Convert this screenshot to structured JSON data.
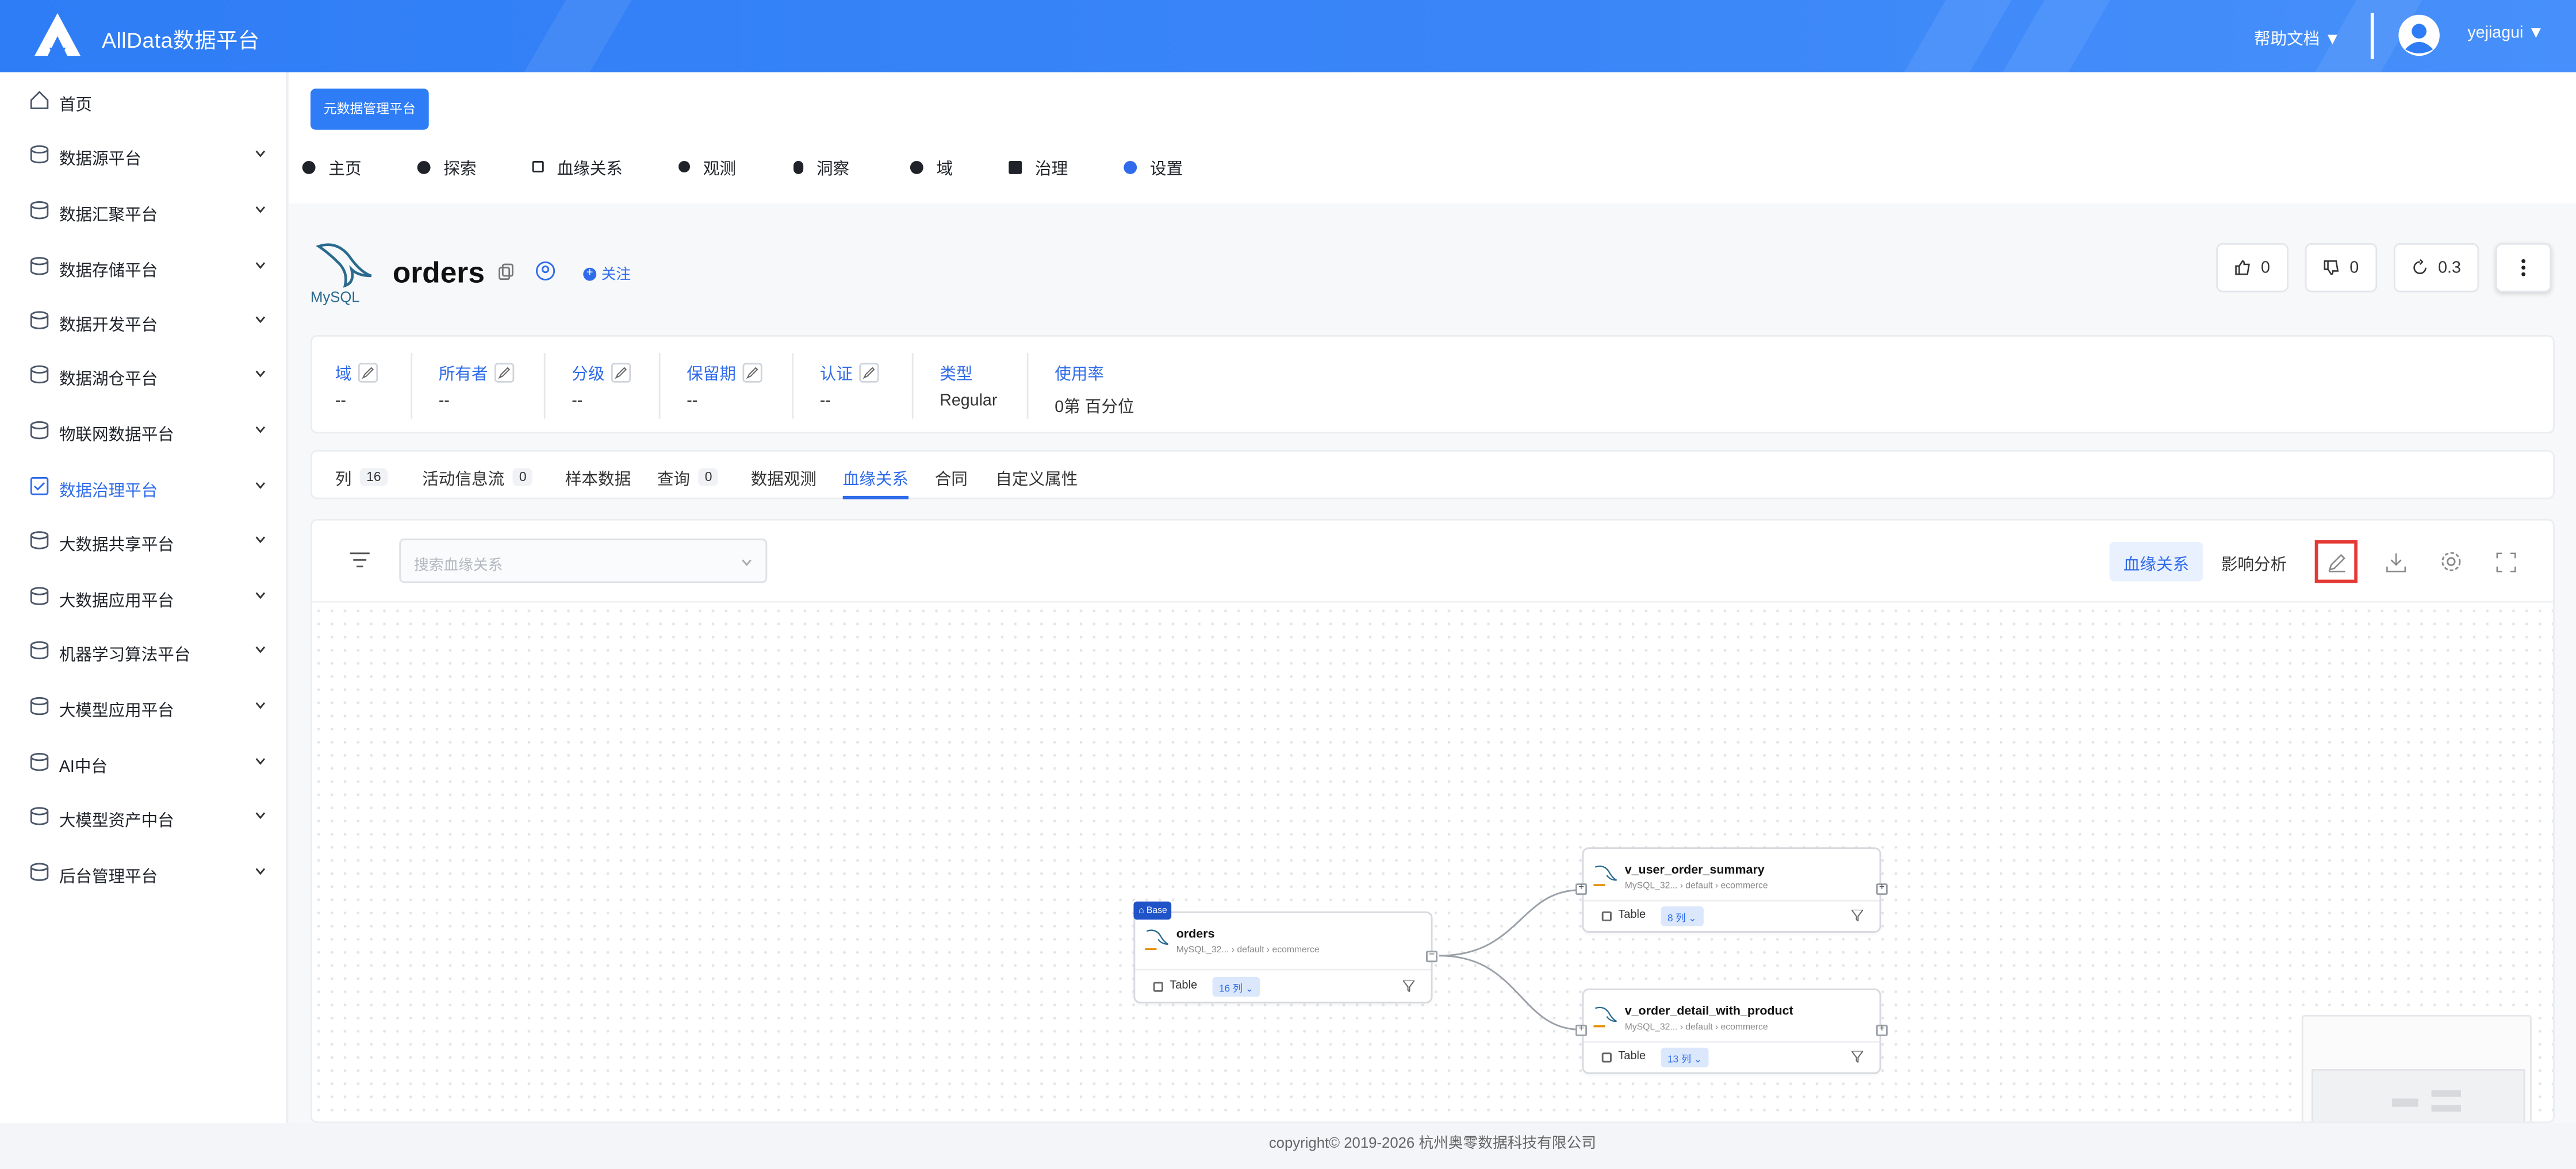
{
  "app": {
    "brand": "AllData数据平台",
    "help": "帮助文档 ▼",
    "user": "yejiagui ▼"
  },
  "sidebar": {
    "items": [
      {
        "label": "首页",
        "icon": "home-icon"
      },
      {
        "label": "数据源平台",
        "icon": "database-icon"
      },
      {
        "label": "数据汇聚平台",
        "icon": "layers-icon"
      },
      {
        "label": "数据存储平台",
        "icon": "bar-chart-icon"
      },
      {
        "label": "数据开发平台",
        "icon": "grid-icon"
      },
      {
        "label": "数据湖仓平台",
        "icon": "lake-icon"
      },
      {
        "label": "物联网数据平台",
        "icon": "iot-icon"
      },
      {
        "label": "数据治理平台",
        "icon": "governance-icon",
        "active": true
      },
      {
        "label": "大数据共享平台",
        "icon": "share-icon"
      },
      {
        "label": "大数据应用平台",
        "icon": "cube-icon"
      },
      {
        "label": "机器学习算法平台",
        "icon": "ml-icon"
      },
      {
        "label": "大模型应用平台",
        "icon": "model-icon"
      },
      {
        "label": "AI中台",
        "icon": "ai-icon"
      },
      {
        "label": "大模型资产中台",
        "icon": "asset-icon"
      },
      {
        "label": "后台管理平台",
        "icon": "admin-icon"
      }
    ]
  },
  "main": {
    "meta_button": "元数据管理平台",
    "nav": [
      "主页",
      "探索",
      "血缘关系",
      "观测",
      "洞察",
      "域",
      "治理",
      "设置"
    ],
    "entity": {
      "name": "orders",
      "follow": "关注",
      "logo_text": "MySQL"
    },
    "stats": {
      "likes": "0",
      "dislikes": "0",
      "version": "0.3"
    },
    "info": [
      {
        "key": "域",
        "value": "--"
      },
      {
        "key": "所有者",
        "value": "--"
      },
      {
        "key": "分级",
        "value": "--"
      },
      {
        "key": "保留期",
        "value": "--"
      },
      {
        "key": "认证",
        "value": "--"
      },
      {
        "key": "类型",
        "value": "Regular"
      },
      {
        "key": "使用率",
        "value": "0第 百分位"
      }
    ],
    "tabs": [
      {
        "label": "列",
        "count": "16"
      },
      {
        "label": "活动信息流",
        "count": "0"
      },
      {
        "label": "样本数据"
      },
      {
        "label": "查询",
        "count": "0"
      },
      {
        "label": "数据观测"
      },
      {
        "label": "血缘关系",
        "active": true
      },
      {
        "label": "合同"
      },
      {
        "label": "自定义属性"
      }
    ],
    "lineage": {
      "search_placeholder": "搜索血缘关系",
      "mode_lineage": "血缘关系",
      "mode_impact": "影响分析",
      "nodes": [
        {
          "name": "orders",
          "path": "MySQL_32...  › default › ecommerce",
          "type": "Table",
          "cols": "16 列 ⌄",
          "badge": "Base"
        },
        {
          "name": "v_user_order_summary",
          "path": "MySQL_32...  › default › ecommerce",
          "type": "Table",
          "cols": "8 列 ⌄"
        },
        {
          "name": "v_order_detail_with_product",
          "path": "MySQL_32...  › default › ecommerce",
          "type": "Table",
          "cols": "13 列 ⌄"
        }
      ]
    }
  },
  "footer": "copyright© 2019-2026 杭州奥零数据科技有限公司"
}
